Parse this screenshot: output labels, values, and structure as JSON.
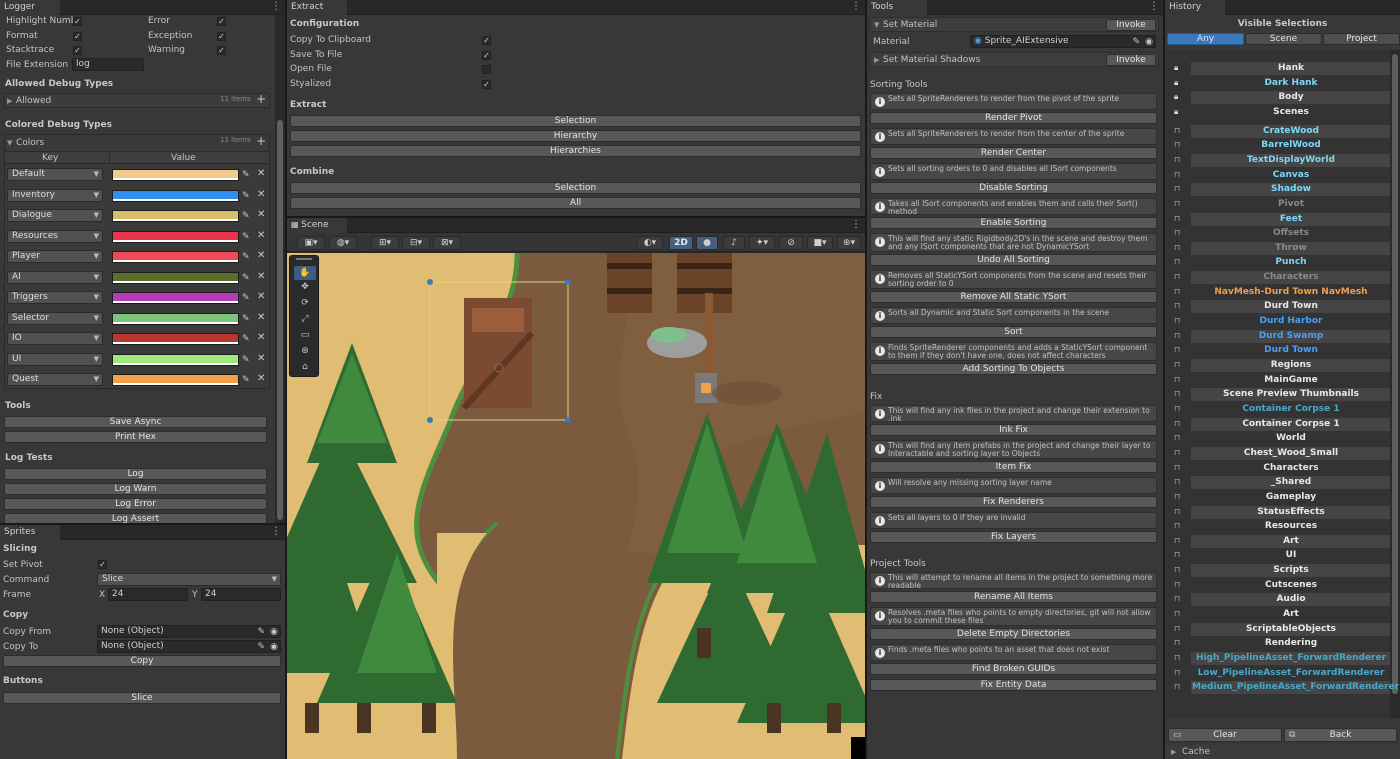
{
  "colors": {
    "accent": "#3a79bb",
    "panel": "#383838",
    "cyan": "#7fd6f5",
    "blue": "#4a9ff5",
    "orange": "#f0a04b"
  },
  "logger": {
    "tab": "Logger",
    "options": [
      {
        "label": "Highlight Numbe",
        "checked": true
      },
      {
        "label": "Error",
        "checked": true
      },
      {
        "label": "Format",
        "checked": true
      },
      {
        "label": "Exception",
        "checked": true
      },
      {
        "label": "Stacktrace",
        "checked": true
      },
      {
        "label": "Warning",
        "checked": true
      }
    ],
    "file_extension_label": "File Extension",
    "file_extension_value": "log",
    "allowed_header": "Allowed Debug Types",
    "allowed_fold": "Allowed",
    "allowed_count": "11 items",
    "colored_header": "Colored Debug Types",
    "colors_fold": "Colors",
    "colors_count": "11 items",
    "key_col": "Key",
    "value_col": "Value",
    "entries": [
      {
        "key": "Default",
        "color": "#f4c98e"
      },
      {
        "key": "Inventory",
        "color": "#2e8ff0"
      },
      {
        "key": "Dialogue",
        "color": "#d8bd6a"
      },
      {
        "key": "Resources",
        "color": "#e8354b"
      },
      {
        "key": "Player",
        "color": "#f04b55"
      },
      {
        "key": "AI",
        "color": "#5c6f2a"
      },
      {
        "key": "Triggers",
        "color": "#b33bbc"
      },
      {
        "key": "Selector",
        "color": "#7fc27a"
      },
      {
        "key": "IO",
        "color": "#b8382e"
      },
      {
        "key": "UI",
        "color": "#9fe879"
      },
      {
        "key": "Quest",
        "color": "#f4a04a"
      }
    ],
    "tools_header": "Tools",
    "save_async": "Save Async",
    "print_hex": "Print Hex",
    "log_tests_header": "Log Tests",
    "log": "Log",
    "log_warn": "Log Warn",
    "log_error": "Log Error",
    "log_assert": "Log Assert"
  },
  "sprites": {
    "tab": "Sprites",
    "slicing_header": "Slicing",
    "set_pivot_label": "Set Pivot",
    "set_pivot": true,
    "command_label": "Command",
    "command_value": "Slice",
    "frame_label": "Frame",
    "frame_x_label": "X",
    "frame_x": "24",
    "frame_y_label": "Y",
    "frame_y": "24",
    "copy_header": "Copy",
    "copy_from_label": "Copy From",
    "copy_from_value": "None (Object)",
    "copy_to_label": "Copy To",
    "copy_to_value": "None (Object)",
    "copy_button": "Copy",
    "buttons_header": "Buttons",
    "slice_button": "Slice"
  },
  "extract": {
    "tab": "Extract",
    "config_header": "Configuration",
    "options": [
      {
        "label": "Copy To Clipboard",
        "checked": true
      },
      {
        "label": "Save To File",
        "checked": true
      },
      {
        "label": "Open File",
        "checked": false
      },
      {
        "label": "Styalized",
        "checked": true
      }
    ],
    "extract_header": "Extract",
    "extract_buttons": [
      "Selection",
      "Hierarchy",
      "Hierarchies"
    ],
    "combine_header": "Combine",
    "combine_buttons": [
      "Selection",
      "All"
    ]
  },
  "scene": {
    "tab": "Scene",
    "mode_2d": "2D"
  },
  "tools": {
    "tab": "Tools",
    "set_material": "Set Material",
    "invoke": "Invoke",
    "material_label": "Material",
    "material_value": "Sprite_AIExtensive",
    "set_material_shadows": "Set Material Shadows",
    "sections": [
      {
        "title": "Sorting Tools",
        "items": [
          {
            "help": "Sets all SpriteRenderers to render from the pivot of the sprite",
            "button": "Render Pivot"
          },
          {
            "help": "Sets all SpriteRenderers to render from the center of the sprite",
            "button": "Render Center"
          },
          {
            "help": "Sets all sorting orders to 0 and disables all ISort components",
            "button": "Disable Sorting"
          },
          {
            "help": "Takes all ISort components and enables them and calls their Sort() method",
            "button": "Enable Sorting"
          },
          {
            "help": "This will find any static Rigidbody2D's in the scene and destroy them and any ISort components that are not DynamicYSort",
            "button": "Undo All Sorting"
          },
          {
            "help": "Removes all StaticYSort components from the scene and resets their sorting order to 0",
            "button": "Remove All Static YSort"
          },
          {
            "help": "Sorts all Dynamic and Static Sort components in the scene",
            "button": "Sort"
          },
          {
            "help": "Finds SpriteRenderer components and adds a StaticYSort component to them if they don't have one, does not affect characters",
            "button": "Add Sorting To Objects"
          }
        ]
      },
      {
        "title": "Fix",
        "items": [
          {
            "help": "This will find any ink files in the project and change their extension to .ink",
            "button": "Ink Fix"
          },
          {
            "help": "This will find any item prefabs in the project and change their layer to Interactable and sorting layer to Objects",
            "button": "Item Fix"
          },
          {
            "help": "Will resolve any missing sorting layer name",
            "button": "Fix Renderers"
          },
          {
            "help": "Sets all layers to 0 if they are invalid",
            "button": "Fix Layers"
          }
        ]
      },
      {
        "title": "Project Tools",
        "items": [
          {
            "help": "This will attempt to rename all items in the project to something more readable",
            "button": "Rename All Items"
          },
          {
            "help": "Resolves .meta files who points to empty directories, git will not allow you to commit these files",
            "button": "Delete Empty Directories"
          },
          {
            "help": "Finds .meta files who points to an asset that does not exist",
            "button": "Find Broken GUIDs"
          },
          {
            "help": "",
            "button": "Fix Entity Data"
          }
        ]
      }
    ]
  },
  "history": {
    "tab": "History",
    "title": "Visible Selections",
    "filters": [
      "Any",
      "Scene",
      "Project"
    ],
    "items": [
      {
        "name": "Hank",
        "color": "#e8e8e8",
        "lock": true
      },
      {
        "name": "Dark Hank",
        "color": "#7fd6f5",
        "lock": true
      },
      {
        "name": "Body",
        "color": "#e8e8e8",
        "lock": true
      },
      {
        "name": "Scenes",
        "color": "#e8e8e8",
        "lock": true
      },
      {
        "name": "CrateWood",
        "color": "#7fd6f5"
      },
      {
        "name": "BarrelWood",
        "color": "#7fd6f5"
      },
      {
        "name": "TextDisplayWorld",
        "color": "#7fd6f5"
      },
      {
        "name": "Canvas",
        "color": "#7fd6f5"
      },
      {
        "name": "Shadow",
        "color": "#7fd6f5"
      },
      {
        "name": "Pivot",
        "color": "#8a8a8a"
      },
      {
        "name": "Feet",
        "color": "#7fd6f5"
      },
      {
        "name": "Offsets",
        "color": "#8a8a8a"
      },
      {
        "name": "Throw",
        "color": "#8a8a8a"
      },
      {
        "name": "Punch",
        "color": "#7fd6f5"
      },
      {
        "name": "Characters",
        "color": "#8a8a8a"
      },
      {
        "name": "NavMesh-Durd Town NavMesh",
        "color": "#f0a04b"
      },
      {
        "name": "Durd Town",
        "color": "#e8e8e8"
      },
      {
        "name": "Durd Harbor",
        "color": "#4a9ff5"
      },
      {
        "name": "Durd Swamp",
        "color": "#4a9ff5"
      },
      {
        "name": "Durd Town",
        "color": "#4a9ff5"
      },
      {
        "name": "Regions",
        "color": "#e8e8e8"
      },
      {
        "name": "MainGame",
        "color": "#e8e8e8"
      },
      {
        "name": "Scene Preview Thumbnails",
        "color": "#e8e8e8"
      },
      {
        "name": "Container Corpse 1",
        "color": "#4aa8c8"
      },
      {
        "name": "Container Corpse 1",
        "color": "#e8e8e8"
      },
      {
        "name": "World",
        "color": "#e8e8e8"
      },
      {
        "name": "Chest_Wood_Small",
        "color": "#e8e8e8"
      },
      {
        "name": "Characters",
        "color": "#e8e8e8"
      },
      {
        "name": "_Shared",
        "color": "#e8e8e8"
      },
      {
        "name": "Gameplay",
        "color": "#e8e8e8"
      },
      {
        "name": "StatusEffects",
        "color": "#e8e8e8"
      },
      {
        "name": "Resources",
        "color": "#e8e8e8"
      },
      {
        "name": "Art",
        "color": "#e8e8e8"
      },
      {
        "name": "UI",
        "color": "#e8e8e8"
      },
      {
        "name": "Scripts",
        "color": "#e8e8e8"
      },
      {
        "name": "Cutscenes",
        "color": "#e8e8e8"
      },
      {
        "name": "Audio",
        "color": "#e8e8e8"
      },
      {
        "name": "Art",
        "color": "#e8e8e8"
      },
      {
        "name": "ScriptableObjects",
        "color": "#e8e8e8"
      },
      {
        "name": "Rendering",
        "color": "#e8e8e8"
      },
      {
        "name": "High_PipelineAsset_ForwardRenderer",
        "color": "#4aa8c8"
      },
      {
        "name": "Low_PipelineAsset_ForwardRenderer",
        "color": "#4aa8c8"
      },
      {
        "name": "Medium_PipelineAsset_ForwardRenderer",
        "color": "#4aa8c8"
      }
    ],
    "clear": "Clear",
    "back": "Back",
    "cache": "Cache"
  }
}
